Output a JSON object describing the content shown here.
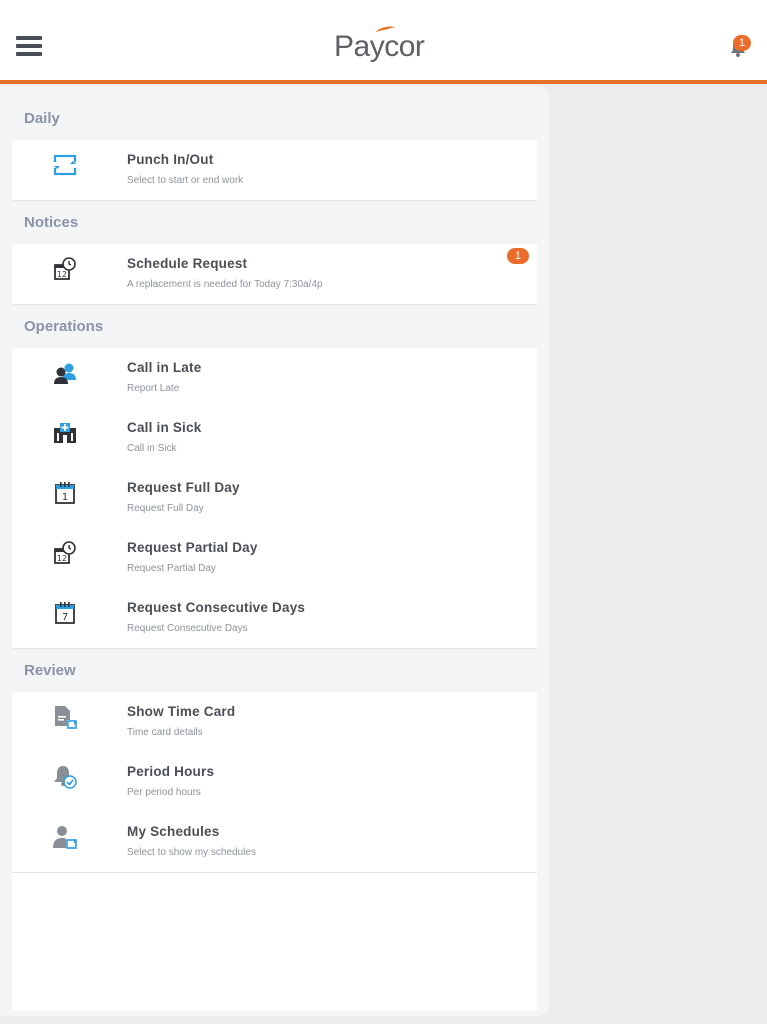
{
  "header": {
    "logo_text": "Paycor",
    "notification_count": "1",
    "colors": {
      "accent": "#e8702a",
      "badge": "#ec6d2b"
    }
  },
  "sections": [
    {
      "title": "Daily",
      "items": [
        {
          "title": "Punch In/Out",
          "subtitle": "Select to start or end work",
          "icon": "punch-icon"
        }
      ]
    },
    {
      "title": "Notices",
      "items": [
        {
          "title": "Schedule Request",
          "subtitle": "A replacement is needed for Today 7:30a/4p",
          "icon": "calendar-clock-icon",
          "badge": "1"
        }
      ]
    },
    {
      "title": "Operations",
      "items": [
        {
          "title": "Call in Late",
          "subtitle": "Report Late",
          "icon": "people-icon"
        },
        {
          "title": "Call in Sick",
          "subtitle": "Call in Sick",
          "icon": "hospital-icon"
        },
        {
          "title": "Request Full Day",
          "subtitle": "Request Full Day",
          "icon": "calendar-1-icon"
        },
        {
          "title": "Request Partial Day",
          "subtitle": "Request Partial Day",
          "icon": "calendar-clock-icon"
        },
        {
          "title": "Request Consecutive Days",
          "subtitle": "Request Consecutive Days",
          "icon": "calendar-7-icon"
        }
      ]
    },
    {
      "title": "Review",
      "items": [
        {
          "title": "Show Time Card",
          "subtitle": "Time card details",
          "icon": "timecard-icon"
        },
        {
          "title": "Period Hours",
          "subtitle": "Per period hours",
          "icon": "bell-check-icon"
        },
        {
          "title": "My Schedules",
          "subtitle": "Select to show my schedules",
          "icon": "person-schedule-icon"
        }
      ]
    }
  ]
}
